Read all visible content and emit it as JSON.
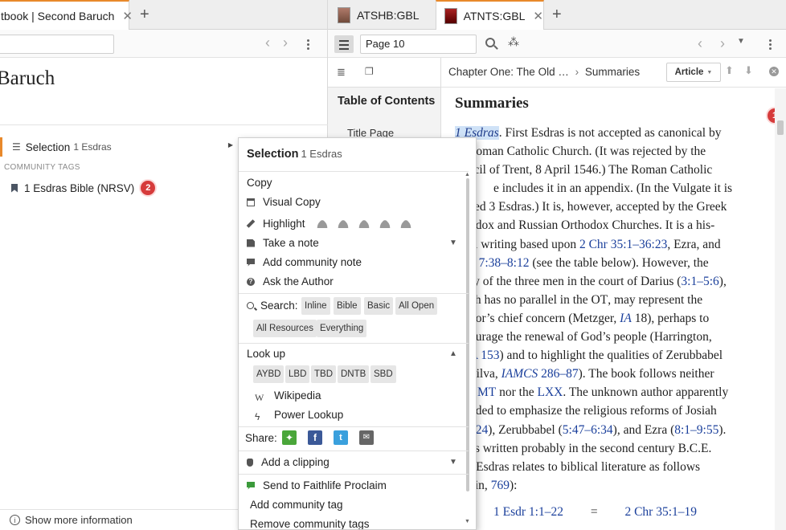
{
  "left": {
    "tab_title": "tbook | Second Baruch",
    "tab_close": "✕",
    "tab_add": "+",
    "heading": "Baruch",
    "selection_label": "Selection",
    "selection_sub": "1 Esdras",
    "community_header": "COMMUNITY TAGS",
    "tag_label": "1 Esdras Bible (NRSV)",
    "tag_badge": "2",
    "footer_label": "Show more information"
  },
  "right": {
    "tabs": [
      {
        "label": "ATSHB:GBL"
      },
      {
        "label": "ATNTS:GBL",
        "close": "✕"
      }
    ],
    "tab_add": "+",
    "page_field": "Page 10",
    "toc_title": "Table of Contents",
    "toc_item": "Title Page",
    "breadcrumb_part1": "Chapter One: The Old …",
    "breadcrumb_sep": "›",
    "breadcrumb_part2": "Summaries",
    "article_button": "Article",
    "badge": "1",
    "article": {
      "heading": "Summaries",
      "highlight": "1 Esdras",
      "lines": [
        ". First Esdras is not accepted as canonical by",
        "Roman Catholic Church. (It was rejected by the",
        "uncil of Trent, 8 April 1546.) The Roman Catholic",
        "e includes it in an appendix. (In the Vulgate it is",
        "ed 3 Esdras.) It is, however, accepted by the Greek",
        "thodox and Russian Orthodox Churches. It is a his-",
        "ical writing based upon ",
        "n ",
        "ry of the three men in the court of Darius (",
        "ch has no parallel in the ",
        "hor’s chief concern (Metzger, ",
        "ourage the renewal of God’s people (Harrington,",
        "A 153",
        ") and to highlight the qualities of Zerubbabel",
        "Silva, ",
        "). The book follows neither",
        "MT",
        " nor the ",
        "LXX",
        ". The unknown author apparently",
        "nded to emphasize the religious reforms of Josiah",
        "–24",
        "), Zerubbabel (",
        "), and Ezra (",
        "as written probably in the second century ",
        "B.C.E.",
        "t Esdras relates to biblical literature as follows",
        "ein, ",
        "):"
      ],
      "refs": {
        "chr": "2 Chr 35:1–36:23",
        "ezra_tail": ", Ezra, and",
        "neh": "7:38–8:12",
        "neh_tail": " (see the table below). However, the",
        "darius": "3:1–5:6",
        "darius_tail": "),",
        "ot": "OT",
        "ot_tail": ", may represent the",
        "ia": "IA",
        "ia_tail": " 18), perhaps to",
        "iamcs": "IAMCS",
        "iamcs_pages": " 286–87",
        "zer": "5:47–6:34",
        "ezra": "8:1–9:55",
        "ezra_end": ").",
        "page": "769"
      },
      "table_left": "1 Esdr 1:1–22",
      "table_eq": "=",
      "table_right": "2 Chr 35:1–19"
    }
  },
  "menu": {
    "header": "Selection",
    "header_sub": "1 Esdras",
    "copy": "Copy",
    "visual_copy": "Visual Copy",
    "highlight": "Highlight",
    "take_note": "Take a note",
    "community_note": "Add community note",
    "ask_author": "Ask the Author",
    "search_label": "Search:",
    "search_chips": [
      "Inline",
      "Bible",
      "Basic",
      "All Open",
      "All Resources",
      "Everything"
    ],
    "lookup": "Look up",
    "lookup_chips": [
      "AYBD",
      "LBD",
      "TBD",
      "DNTB",
      "SBD"
    ],
    "wikipedia": "Wikipedia",
    "power_lookup": "Power Lookup",
    "share": "Share:",
    "clipping": "Add a clipping",
    "proclaim": "Send to Faithlife Proclaim",
    "add_tag": "Add community tag",
    "remove_tag": "Remove community tags"
  },
  "colors": {
    "accent": "#e8892b",
    "badge": "#d63b3b",
    "link": "#1a3f9b",
    "selection_highlight": "#cfe2f7"
  }
}
